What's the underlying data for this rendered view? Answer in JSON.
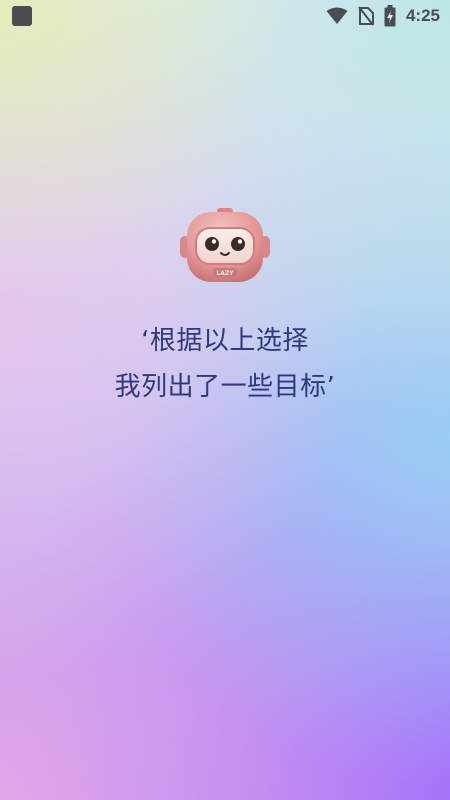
{
  "status_bar": {
    "time": "4:25",
    "icons": [
      "app-indicator-icon",
      "wifi-icon",
      "no-sim-icon",
      "battery-charging-icon"
    ]
  },
  "mascot": {
    "icon": "robot-mascot-icon",
    "badge": "LAZY",
    "colors": {
      "shell": "#e59a98",
      "visor": "#f4d9d6",
      "eye": "#3a2b2d"
    }
  },
  "message": {
    "line1": "‘根据以上选择",
    "line2": "我列出了一些目标’"
  },
  "colors": {
    "text": "#2f3a7a",
    "status_icons": "#4a4d4f"
  }
}
